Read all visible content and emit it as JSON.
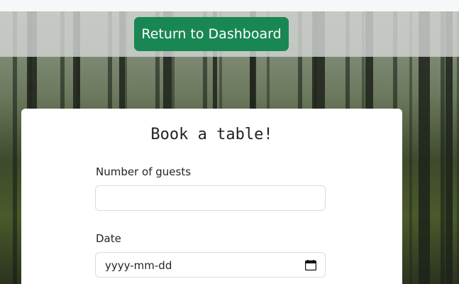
{
  "header": {
    "return_label": "Return to Dashboard"
  },
  "booking_form": {
    "title": "Book a table!",
    "guests": {
      "label": "Number of guests",
      "value": ""
    },
    "date": {
      "label": "Date",
      "placeholder": "yyyy-mm-dd",
      "icon": "calendar-icon"
    }
  },
  "colors": {
    "primary_button": "#198754",
    "card_background": "#ffffff"
  }
}
